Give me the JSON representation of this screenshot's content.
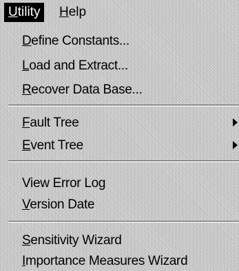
{
  "menubar": {
    "utility": {
      "mnemonic": "U",
      "rest": "tility"
    },
    "help": {
      "mnemonic": "H",
      "rest": "elp"
    }
  },
  "menu": {
    "define_constants": {
      "mnemonic": "D",
      "rest": "efine Constants..."
    },
    "load_and_extract": {
      "mnemonic": "L",
      "rest": "oad and Extract..."
    },
    "recover_database": {
      "mnemonic": "R",
      "rest": "ecover Data Base..."
    },
    "fault_tree": {
      "mnemonic": "F",
      "rest": "ault Tree"
    },
    "event_tree": {
      "mnemonic": "E",
      "rest": "vent Tree"
    },
    "view_error_log": {
      "before": "View Error Lo",
      "mnemonic": "g"
    },
    "version_date": {
      "mnemonic": "V",
      "rest": "ersion Date"
    },
    "sensitivity_wizard": {
      "mnemonic": "S",
      "rest": "ensitivity Wizard"
    },
    "importance_measures_wizard": {
      "mnemonic": "I",
      "rest": "mportance Measures Wizard"
    }
  }
}
